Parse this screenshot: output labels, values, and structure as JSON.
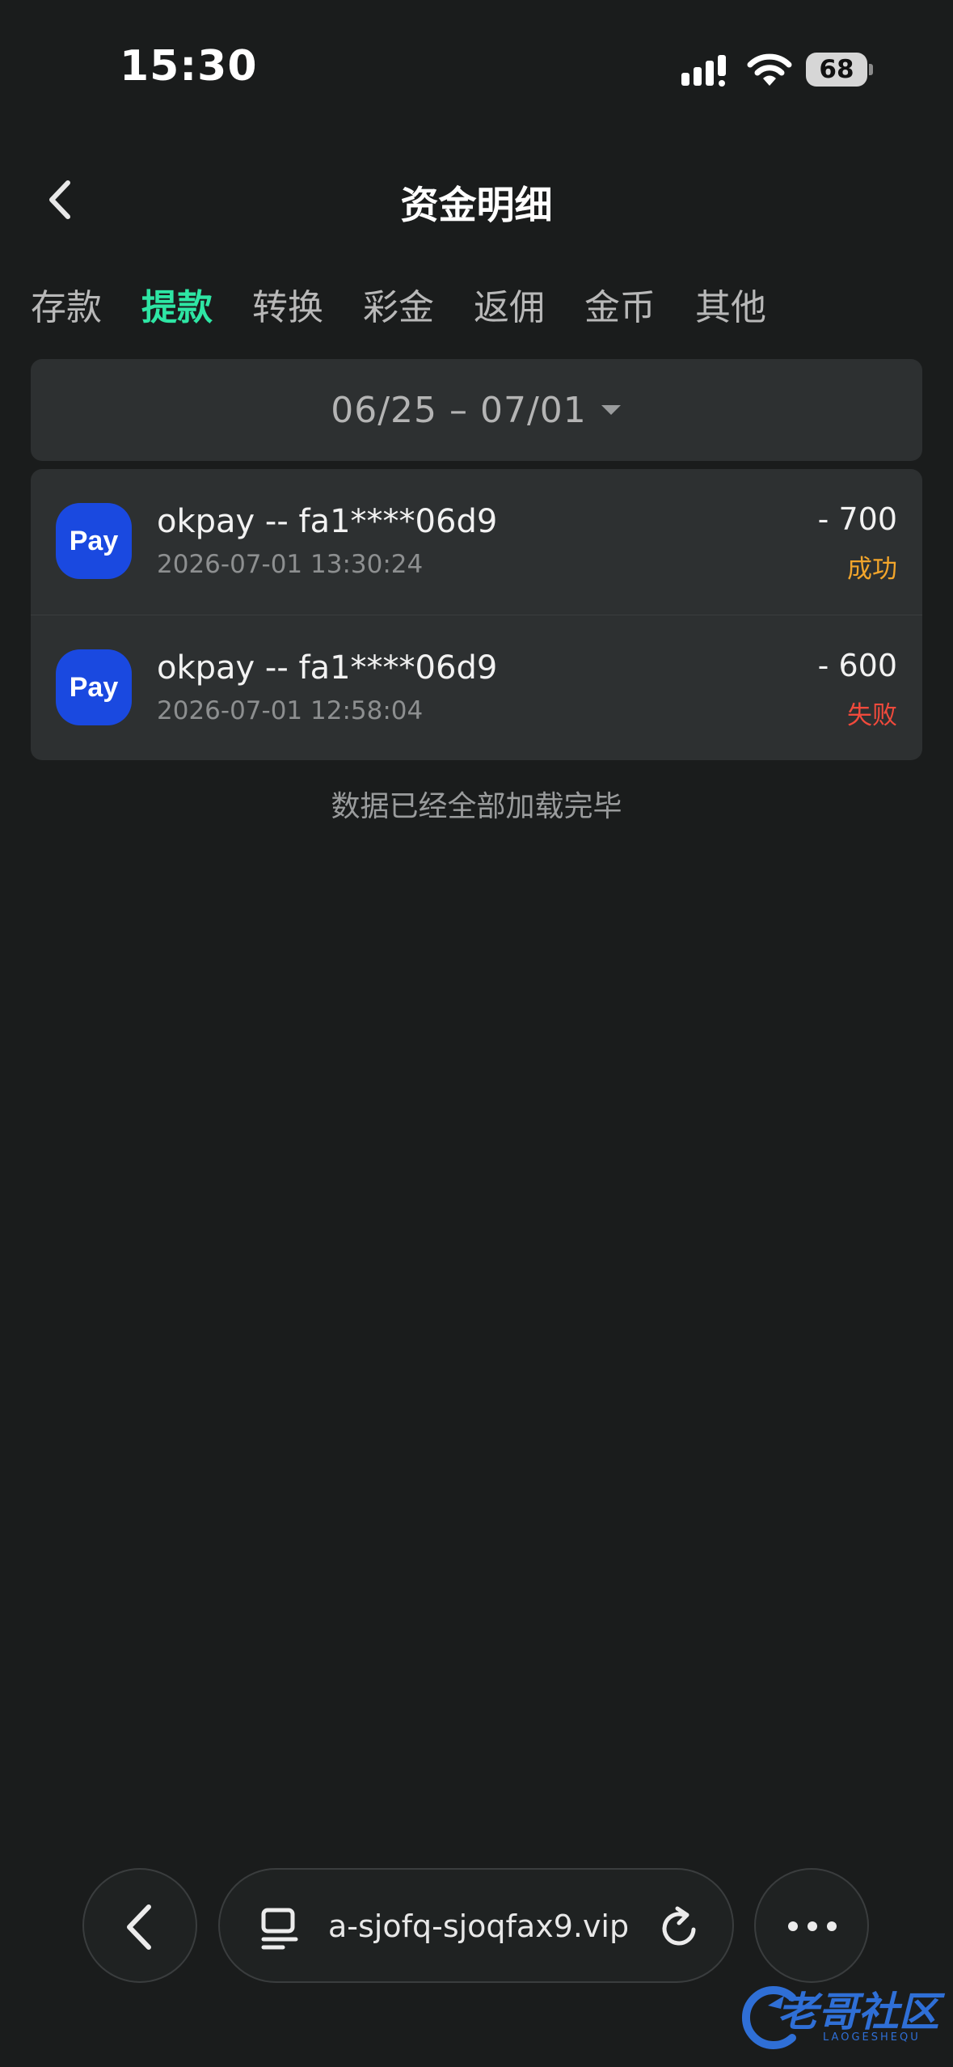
{
  "status_bar": {
    "time": "15:30",
    "battery": "68"
  },
  "header": {
    "title": "资金明细"
  },
  "tabs": [
    {
      "label": "存款",
      "active": false
    },
    {
      "label": "提款",
      "active": true
    },
    {
      "label": "转换",
      "active": false
    },
    {
      "label": "彩金",
      "active": false
    },
    {
      "label": "返佣",
      "active": false
    },
    {
      "label": "金币",
      "active": false
    },
    {
      "label": "其他",
      "active": false
    }
  ],
  "filter": {
    "date_range": "06/25 – 07/01"
  },
  "records": [
    {
      "logo": "Pay",
      "name": "okpay -- fa1****06d9",
      "time": "2026-07-01 13:30:24",
      "amount": "- 700",
      "status": "成功"
    },
    {
      "logo": "Pay",
      "name": "okpay -- fa1****06d9",
      "time": "2026-07-01 12:58:04",
      "amount": "- 600",
      "status": "失败"
    }
  ],
  "list_footer": "数据已经全部加载完毕",
  "browser": {
    "url": "a-sjofq-sjoqfax9.vip"
  },
  "watermark": {
    "text": "老哥社区",
    "sub": "LAOGESHEQU"
  },
  "colors": {
    "background": "#1a1c1c",
    "card": "#2d3031",
    "accent": "#2ee6a4",
    "success": "#f2a52b",
    "failed": "#f04a3c",
    "pay_logo": "#1a49e0"
  }
}
